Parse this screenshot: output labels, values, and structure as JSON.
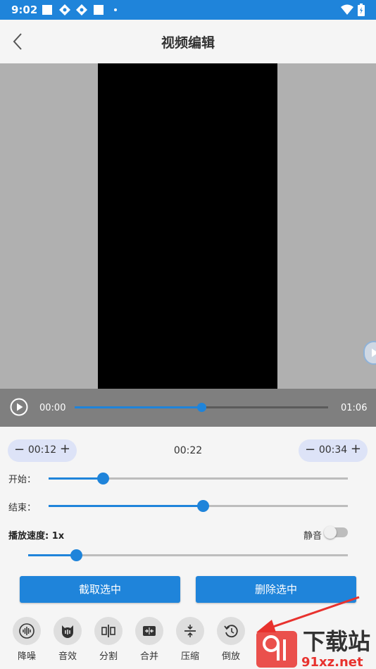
{
  "status_bar": {
    "time": "9:02"
  },
  "header": {
    "title": "视频编辑"
  },
  "player": {
    "current_time": "00:00",
    "duration": "01:06",
    "progress": 0.5
  },
  "trim": {
    "start_value": "00:12",
    "selected_duration": "00:22",
    "end_value": "00:34",
    "start_label": "开始：",
    "end_label": "结束：",
    "start_fraction": 0.18,
    "end_fraction": 0.515
  },
  "speed": {
    "label": "播放速度:",
    "value": "1x",
    "fraction": 0.15
  },
  "mute": {
    "label": "静音",
    "enabled": false
  },
  "actions": {
    "cut_label": "截取选中",
    "delete_label": "删除选中"
  },
  "tools": [
    {
      "label": "降噪",
      "icon": "noise-reduction-icon"
    },
    {
      "label": "音效",
      "icon": "sound-effect-icon"
    },
    {
      "label": "分割",
      "icon": "split-icon"
    },
    {
      "label": "合并",
      "icon": "merge-icon"
    },
    {
      "label": "压缩",
      "icon": "compress-icon"
    },
    {
      "label": "倒放",
      "icon": "reverse-icon"
    }
  ],
  "watermark": {
    "text": "下载站",
    "site": "91xz.net"
  },
  "colors": {
    "accent": "#1f84da",
    "pill": "#dde3f7",
    "annotation": "#e8322e"
  }
}
